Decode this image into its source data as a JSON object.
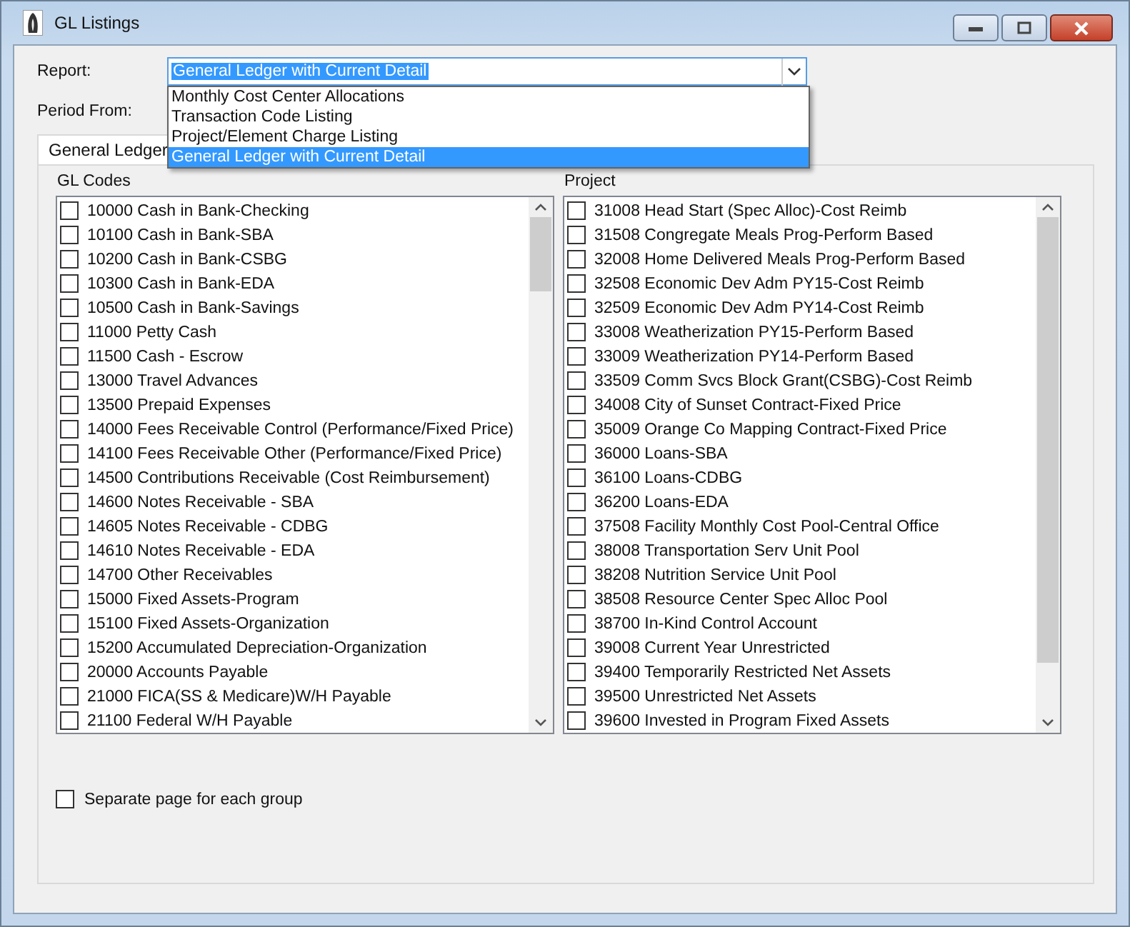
{
  "window": {
    "title": "GL Listings"
  },
  "report": {
    "label": "Report:",
    "value": "General Ledger with Current Detail",
    "options": [
      {
        "label": "Monthly Cost Center Allocations",
        "selected": false
      },
      {
        "label": "Transaction Code Listing",
        "selected": false
      },
      {
        "label": "Project/Element Charge Listing",
        "selected": false
      },
      {
        "label": "General Ledger with Current Detail",
        "selected": true
      }
    ]
  },
  "period_from": {
    "label": "Period From:"
  },
  "tabs": [
    {
      "label": "General Ledger",
      "selected": true
    }
  ],
  "lists": [
    {
      "title": "GL Codes",
      "items": [
        {
          "label": "10000 Cash in Bank-Checking",
          "checked": false
        },
        {
          "label": "10100 Cash in Bank-SBA",
          "checked": false
        },
        {
          "label": "10200 Cash in Bank-CSBG",
          "checked": false
        },
        {
          "label": "10300 Cash in Bank-EDA",
          "checked": false
        },
        {
          "label": "10500 Cash in Bank-Savings",
          "checked": false
        },
        {
          "label": "11000 Petty Cash",
          "checked": false
        },
        {
          "label": "11500 Cash - Escrow",
          "checked": false
        },
        {
          "label": "13000 Travel Advances",
          "checked": false
        },
        {
          "label": "13500 Prepaid Expenses",
          "checked": false
        },
        {
          "label": "14000 Fees Receivable Control (Performance/Fixed Price)",
          "checked": false
        },
        {
          "label": "14100 Fees Receivable Other (Performance/Fixed Price)",
          "checked": false
        },
        {
          "label": "14500 Contributions Receivable (Cost Reimbursement)",
          "checked": false
        },
        {
          "label": "14600 Notes Receivable - SBA",
          "checked": false
        },
        {
          "label": "14605 Notes Receivable - CDBG",
          "checked": false
        },
        {
          "label": "14610 Notes Receivable - EDA",
          "checked": false
        },
        {
          "label": "14700 Other Receivables",
          "checked": false
        },
        {
          "label": "15000 Fixed Assets-Program",
          "checked": false
        },
        {
          "label": "15100 Fixed Assets-Organization",
          "checked": false
        },
        {
          "label": "15200 Accumulated Depreciation-Organization",
          "checked": false
        },
        {
          "label": "20000 Accounts Payable",
          "checked": false
        },
        {
          "label": "21000 FICA(SS & Medicare)W/H Payable",
          "checked": false
        },
        {
          "label": "21100 Federal W/H Payable",
          "checked": false
        }
      ]
    },
    {
      "title": "Project",
      "items": [
        {
          "label": "31008 Head Start (Spec Alloc)-Cost Reimb",
          "checked": false
        },
        {
          "label": "31508 Congregate Meals Prog-Perform Based",
          "checked": false
        },
        {
          "label": "32008 Home Delivered Meals Prog-Perform Based",
          "checked": false
        },
        {
          "label": "32508 Economic Dev Adm PY15-Cost Reimb",
          "checked": false
        },
        {
          "label": "32509 Economic Dev Adm PY14-Cost Reimb",
          "checked": false
        },
        {
          "label": "33008 Weatherization PY15-Perform Based",
          "checked": false
        },
        {
          "label": "33009 Weatherization  PY14-Perform Based",
          "checked": false
        },
        {
          "label": "33509 Comm Svcs Block Grant(CSBG)-Cost Reimb",
          "checked": false
        },
        {
          "label": "34008 City of Sunset Contract-Fixed Price",
          "checked": false
        },
        {
          "label": "35009 Orange Co Mapping Contract-Fixed Price",
          "checked": false
        },
        {
          "label": "36000 Loans-SBA",
          "checked": false
        },
        {
          "label": "36100 Loans-CDBG",
          "checked": false
        },
        {
          "label": "36200 Loans-EDA",
          "checked": false
        },
        {
          "label": "37508 Facility Monthly Cost Pool-Central Office",
          "checked": false
        },
        {
          "label": "38008 Transportation Serv Unit Pool",
          "checked": false
        },
        {
          "label": "38208 Nutrition Service Unit Pool",
          "checked": false
        },
        {
          "label": "38508 Resource Center Spec Alloc Pool",
          "checked": false
        },
        {
          "label": "38700 In-Kind Control Account",
          "checked": false
        },
        {
          "label": "39008 Current Year Unrestricted",
          "checked": false
        },
        {
          "label": "39400 Temporarily Restricted Net Assets",
          "checked": false
        },
        {
          "label": "39500 Unrestricted Net Assets",
          "checked": false
        },
        {
          "label": "39600 Invested in Program Fixed Assets",
          "checked": false
        }
      ]
    }
  ],
  "separate_page": {
    "label": "Separate page for each group",
    "checked": false
  }
}
